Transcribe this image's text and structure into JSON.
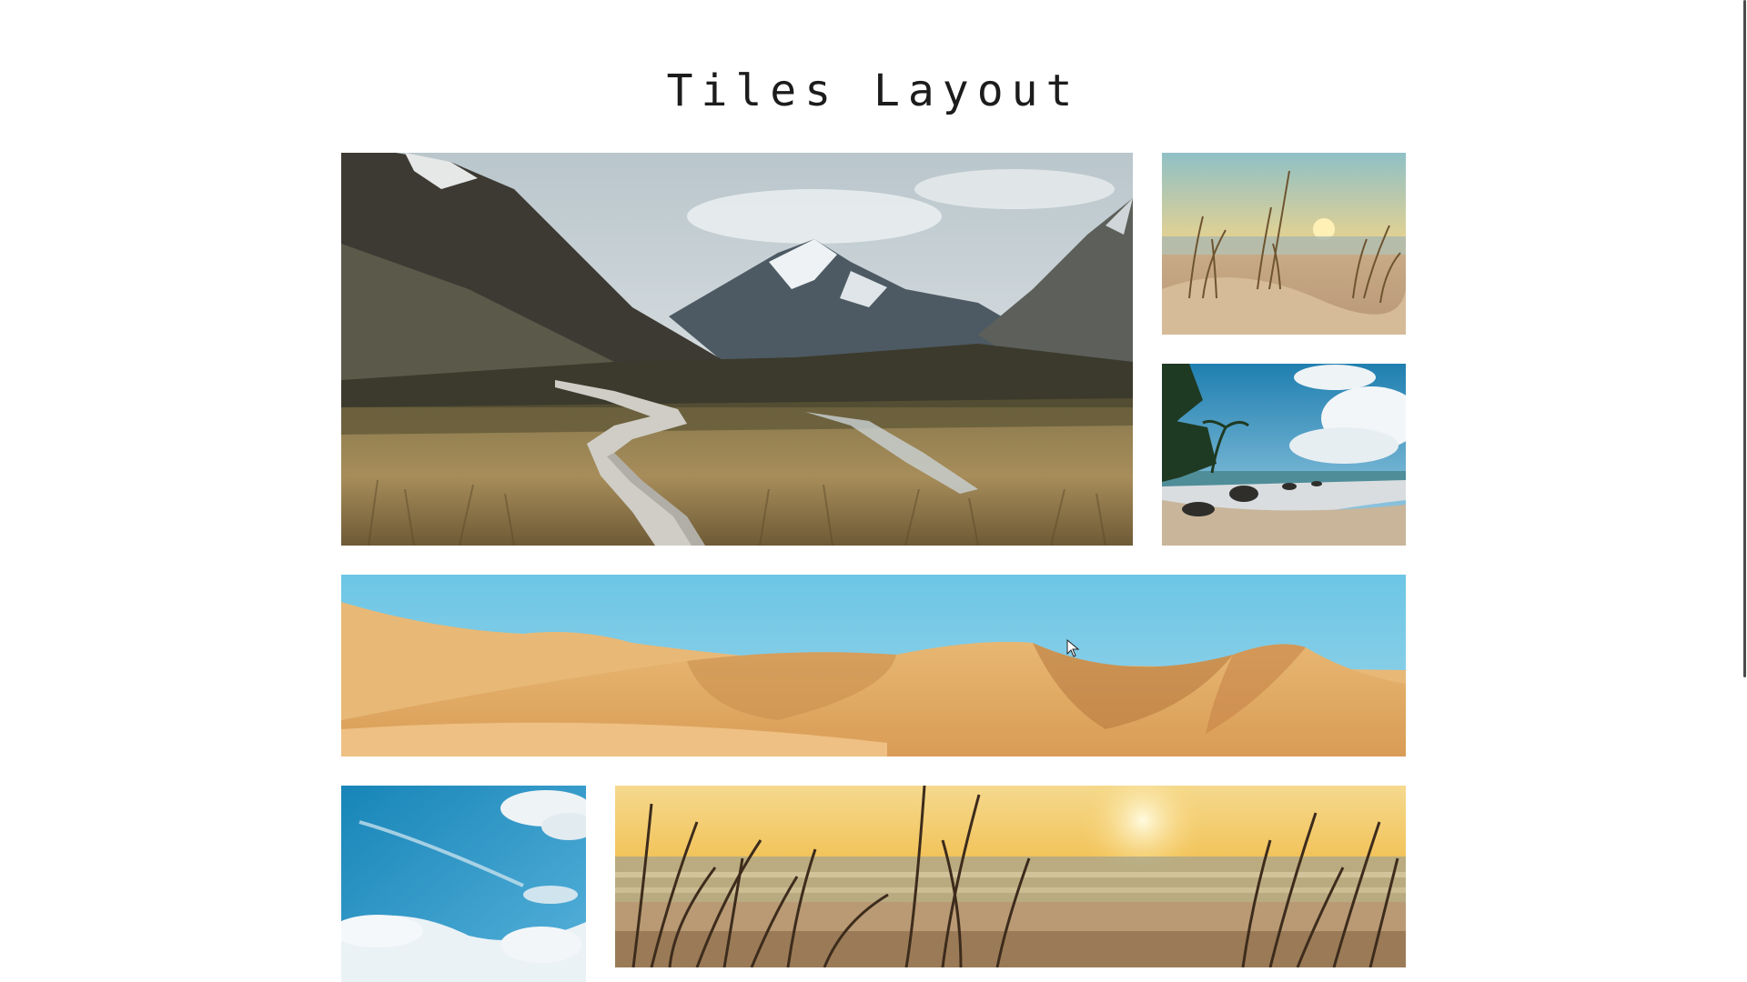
{
  "page": {
    "title": "Tiles Layout"
  },
  "tiles": [
    {
      "name": "mountain-valley-boardwalk-image"
    },
    {
      "name": "beach-grass-sunset-small-image"
    },
    {
      "name": "tropical-beach-palms-image"
    },
    {
      "name": "desert-dunes-banner-image"
    },
    {
      "name": "blue-sky-clouds-image"
    },
    {
      "name": "beach-grass-sunset-wide-image"
    }
  ],
  "colors": {
    "background": "#ffffff",
    "title": "#1c1c1c",
    "sky_blue": "#6cc6e6",
    "sand": "#e3b26e",
    "sunset": "#f2c35a"
  }
}
